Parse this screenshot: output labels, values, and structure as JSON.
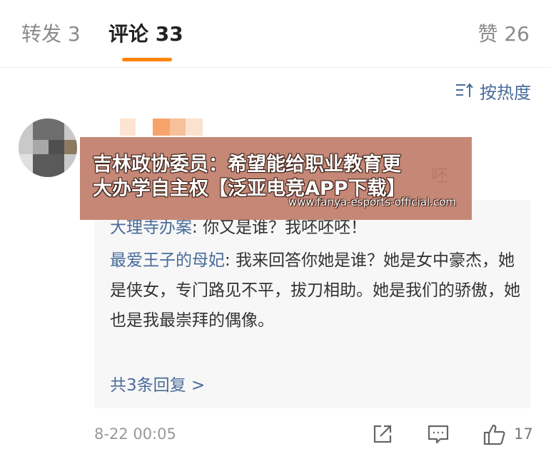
{
  "tabs": {
    "forward": "转发 3",
    "comments": "评论 33",
    "likes": "赞 26"
  },
  "sort": {
    "label": "按热度",
    "icon": "sort-icon"
  },
  "comment": {
    "partial_text": "呸",
    "replies": [
      {
        "author": "大理寺办案",
        "text": ": 你又是谁？我呸呸呸！"
      },
      {
        "author": "最爱王子的母妃",
        "text": ": 我来回答你她是谁？她是女中豪杰，她是侠女，专门路见不平，拔刀相助。她是我们的骄傲，她也是我最崇拜的偶像。"
      }
    ],
    "more_replies": "共3条回复 >",
    "time": "8-22 00:05",
    "like_count": "17"
  },
  "banner": {
    "line1": "吉林政协委员：希望能给职业教育更",
    "line2": "大办学自主权【泛亚电竞APP下载】",
    "url": "www.fanya-esports-official.com"
  },
  "colors": {
    "accent": "#ff8200",
    "link": "#4a6c99",
    "banner_bg": "#c07e6a"
  }
}
